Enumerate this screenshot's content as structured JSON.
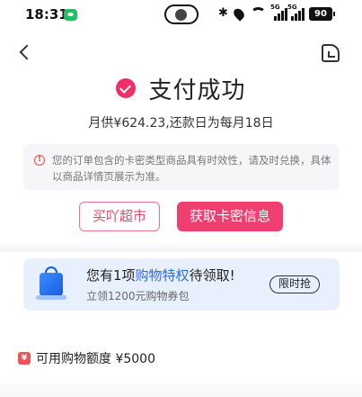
{
  "status_bar": {
    "time": "18:31",
    "signal_label": "5G",
    "battery": "90"
  },
  "success": {
    "title": "支付成功",
    "repay_info": "月供¥624.23,还款日为每月18日"
  },
  "notice": {
    "text": "您的订单包含的卡密类型商品具有时效性，请及时兑换，具体以商品详情页展示为准。"
  },
  "buttons": {
    "supermarket": "买吖超市",
    "get_card_info": "获取卡密信息"
  },
  "promo": {
    "title_prefix": "您有1项",
    "title_highlight": "购物特权",
    "title_suffix": "待领取!",
    "subtitle": "立领1200元购物券包",
    "action": "限时抢"
  },
  "credit": {
    "text": "可用购物额度 ¥5000"
  },
  "colors": {
    "accent": "#ee3f70",
    "highlight_blue": "#2f6bf0",
    "promo_bg": "#e9f0fd"
  }
}
